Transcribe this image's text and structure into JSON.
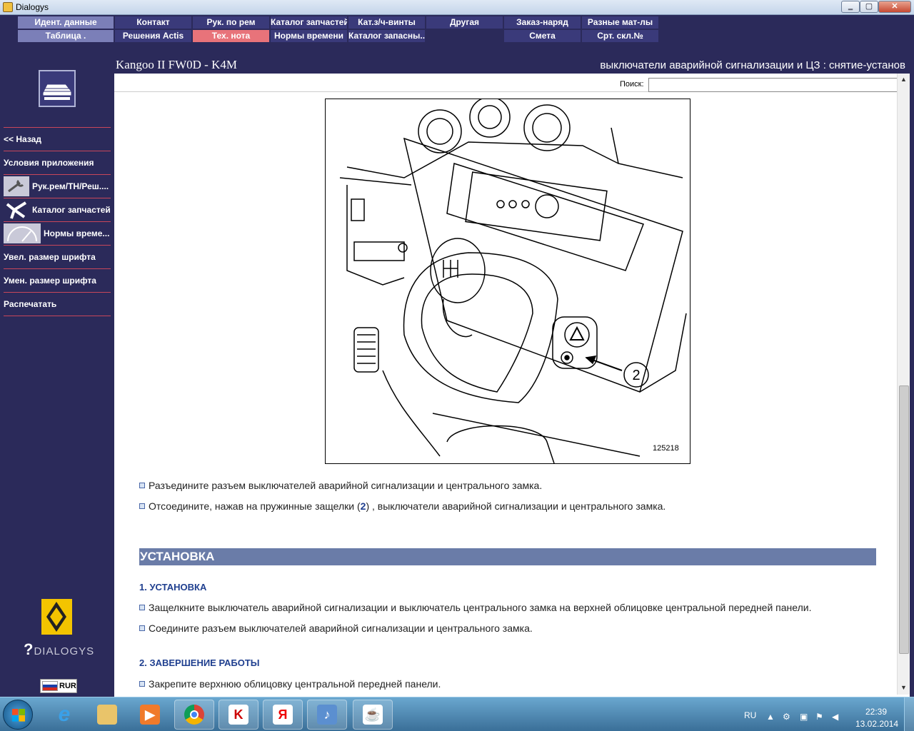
{
  "window": {
    "title": "Dialogys",
    "min": "‗",
    "max": "▢",
    "close": "✕"
  },
  "menu": {
    "row1": [
      "Идент. данные",
      "Контакт",
      "Рук. по рем",
      "Каталог запчастей",
      "Кат.з/ч-винты",
      "Другая",
      "Заказ-наряд",
      "Разные мат-лы"
    ],
    "row2": [
      "Таблица .",
      "Решения Actis",
      "Тех. нота",
      "Нормы времени",
      "Каталог запасны...",
      "Смета",
      "Срт. скл.№"
    ],
    "active": "Тех. нота"
  },
  "header": {
    "model": "Kangoo II FW0D - K4M",
    "doc_title": "выключатели аварийной сигнализации и ЦЗ : снятие-установ"
  },
  "sidebar": {
    "items": [
      "<< Назад",
      "Условия приложения",
      "Рук.рем/ТН/Реш....",
      "Каталог запчастей",
      "Нормы време...",
      "Увел. размер шрифта",
      "Умен. размер шрифта",
      "Распечатать"
    ],
    "brand": "DIALOGYS",
    "currency": "RUR"
  },
  "search": {
    "label": "Поиск:",
    "value": ""
  },
  "figure": {
    "callout": "2",
    "figure_number": "125218"
  },
  "content": {
    "step1": "Разъедините разъем выключателей аварийной сигнализации и центрального замка.",
    "step2_before": "Отсоедините, нажав на пружинные защелки (",
    "step2_ref": "2",
    "step2_after": ") , выключатели аварийной сигнализации и центрального замка.",
    "section_title": "УСТАНОВКА",
    "sub1": "1. УСТАНОВКА",
    "install1": "Защелкните выключатель аварийной сигнализации и выключатель центрального замка на верхней облицовке центральной передней панели.",
    "install2": "Соедините разъем выключателей аварийной сигнализации и центрального замка.",
    "sub2": "2. ЗАВЕРШЕНИЕ РАБОТЫ",
    "finish1": "Закрепите верхнюю облицовку центральной передней панели."
  },
  "taskbar": {
    "apps": [
      "internet-explorer",
      "explorer",
      "media-player",
      "chrome",
      "kaspersky",
      "yandex-browser",
      "audio-app",
      "java-app"
    ],
    "yandex_letter": "Я",
    "lang": "RU",
    "time": "22:39",
    "date": "13.02.2014"
  }
}
